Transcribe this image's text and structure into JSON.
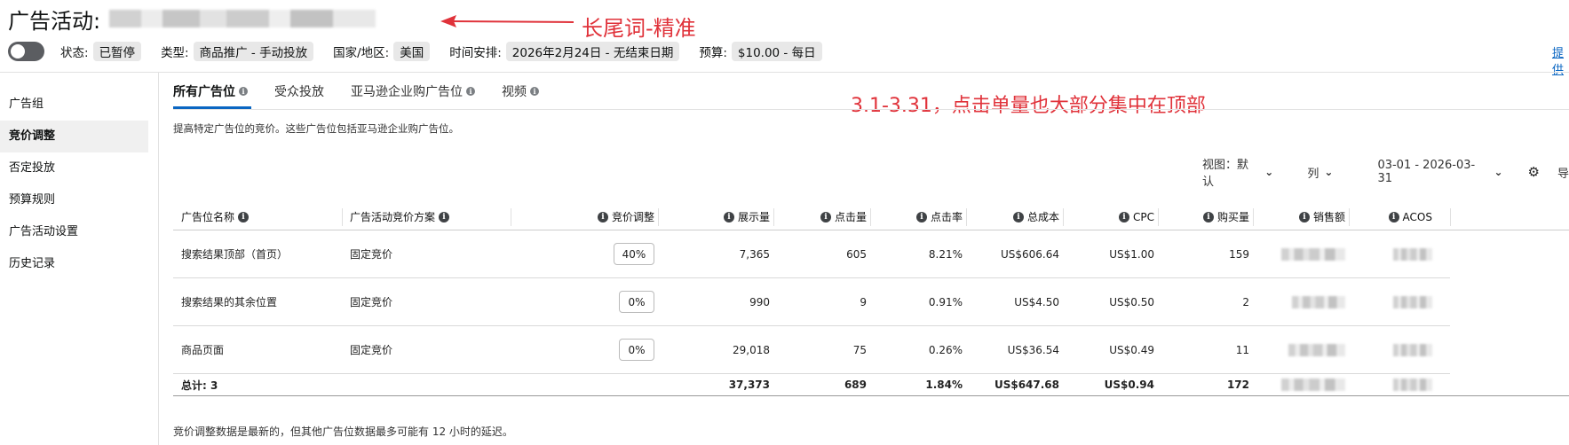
{
  "header": {
    "title": "广告活动:",
    "annotation_title": "长尾词-精准",
    "annotation_note": "3.1-3.31，点击单量也大部分集中在顶部",
    "offer_link": "提供"
  },
  "meta": [
    {
      "label": "状态:",
      "value": "已暂停"
    },
    {
      "label": "类型:",
      "value": "商品推广 - 手动投放"
    },
    {
      "label": "国家/地区:",
      "value": "美国"
    },
    {
      "label": "时间安排:",
      "value": "2026年2月24日 - 无结束日期"
    },
    {
      "label": "预算:",
      "value": "$10.00 - 每日"
    }
  ],
  "sidebar": {
    "items": [
      {
        "label": "广告组"
      },
      {
        "label": "竞价调整",
        "active": true
      },
      {
        "label": "否定投放"
      },
      {
        "label": "预算规则"
      },
      {
        "label": "广告活动设置"
      },
      {
        "label": "历史记录"
      }
    ]
  },
  "tabs": [
    {
      "label": "所有广告位",
      "active": true
    },
    {
      "label": "受众投放"
    },
    {
      "label": "亚马逊企业购广告位"
    },
    {
      "label": "视频"
    }
  ],
  "description": "提高特定广告位的竞价。这些广告位包括亚马逊企业购广告位。",
  "controls": {
    "view_label": "视图：默认",
    "columns_label": "列",
    "date_range": "03-01 - 2026-03-31",
    "export_label": "导"
  },
  "table": {
    "columns": [
      "广告位名称",
      "广告活动竞价方案",
      "竞价调整",
      "展示量",
      "点击量",
      "点击率",
      "总成本",
      "CPC",
      "购买量",
      "销售额",
      "ACOS"
    ],
    "rows": [
      {
        "name": "搜索结果顶部（首页）",
        "strategy": "固定竞价",
        "bid": "40%",
        "impressions": "7,365",
        "clicks": "605",
        "ctr": "8.21%",
        "cost": "US$606.64",
        "cpc": "US$1.00",
        "orders": "159"
      },
      {
        "name": "搜索结果的其余位置",
        "strategy": "固定竞价",
        "bid": "0%",
        "impressions": "990",
        "clicks": "9",
        "ctr": "0.91%",
        "cost": "US$4.50",
        "cpc": "US$0.50",
        "orders": "2"
      },
      {
        "name": "商品页面",
        "strategy": "固定竞价",
        "bid": "0%",
        "impressions": "29,018",
        "clicks": "75",
        "ctr": "0.26%",
        "cost": "US$36.54",
        "cpc": "US$0.49",
        "orders": "11"
      }
    ],
    "total": {
      "name": "总计: 3",
      "impressions": "37,373",
      "clicks": "689",
      "ctr": "1.84%",
      "cost": "US$647.68",
      "cpc": "US$0.94",
      "orders": "172"
    }
  },
  "footnote": "竞价调整数据是最新的，但其他广告位数据最多可能有 12 小时的延迟。",
  "colors": {
    "accent": "#0a66c2",
    "annotation": "#e0323a"
  }
}
